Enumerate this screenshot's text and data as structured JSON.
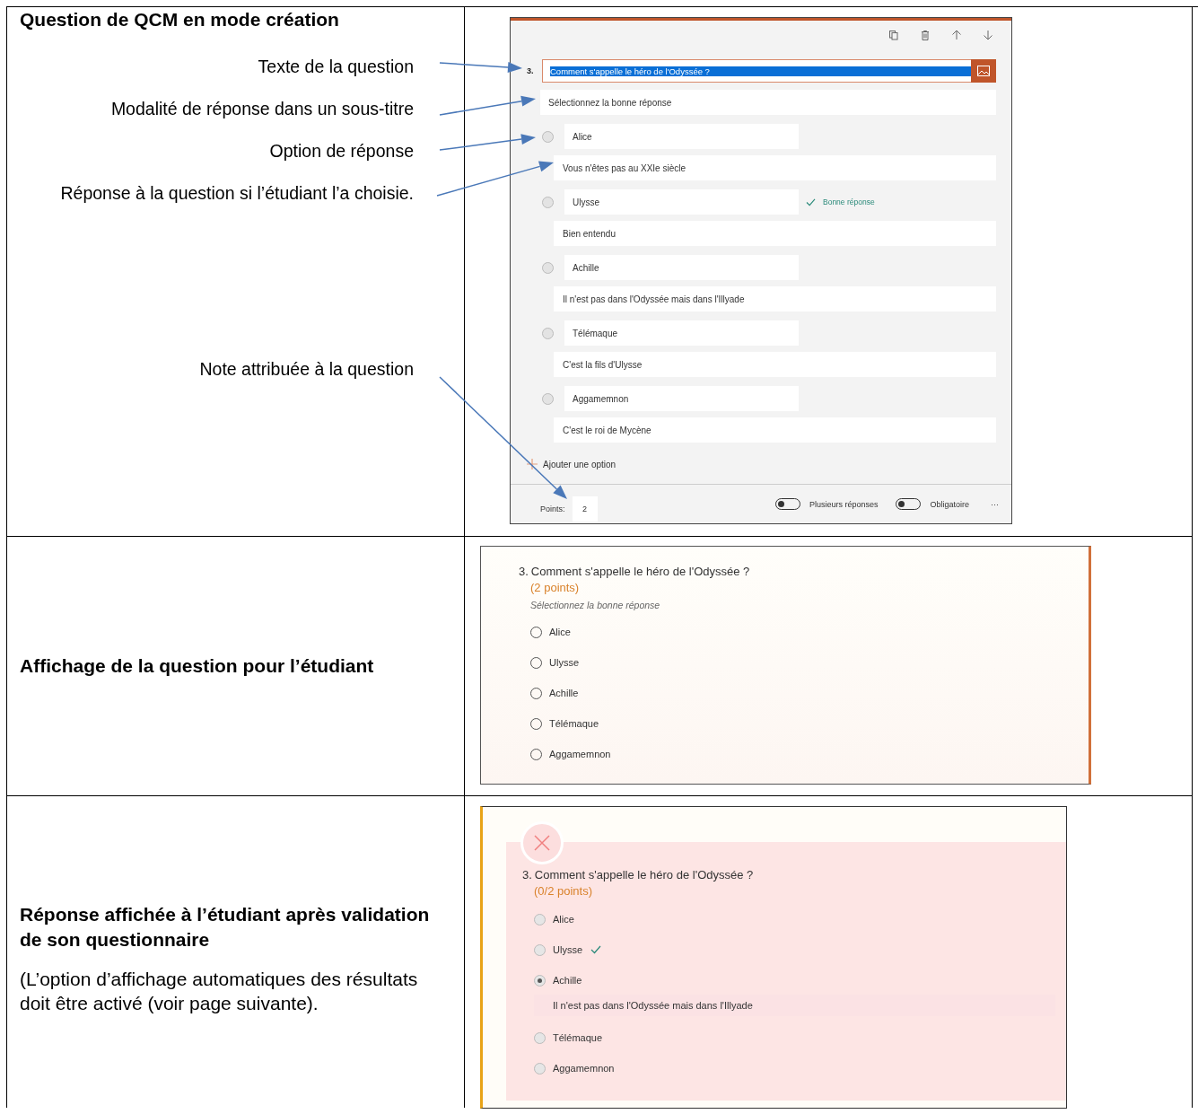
{
  "creation": {
    "heading": "Question de QCM en mode création",
    "annotations": [
      "Texte de la question",
      "Modalité de réponse dans un sous-titre",
      "Option de réponse",
      "Réponse à la question si l’étudiant l’a choisie.",
      "Note attribuée à la question"
    ],
    "editor": {
      "number": "3.",
      "question": "Comment s'appelle le héro de l'Odyssée ?",
      "question_selected": true,
      "subtitle": "Sélectionnez la bonne réponse",
      "correct_label": "Bonne réponse",
      "options": [
        {
          "label": "Alice",
          "feedback": "Vous n'êtes pas au XXIe siècle",
          "correct": false,
          "selected": false
        },
        {
          "label": "Ulysse",
          "feedback": "Bien entendu",
          "correct": true,
          "selected": false
        },
        {
          "label": "Achille",
          "feedback": "Il n'est pas dans l'Odyssée mais dans l'Illyade",
          "correct": false,
          "selected": false
        },
        {
          "label": "Télémaque",
          "feedback": "C'est la fils d'Ulysse",
          "correct": false,
          "selected": false
        },
        {
          "label": "Aggamemnon",
          "feedback": "C'est le roi de Mycène",
          "correct": false,
          "selected": false
        }
      ],
      "add_option": "Ajouter une option",
      "points_label": "Points:",
      "points": "2",
      "toggles": [
        {
          "label": "Plusieurs réponses",
          "on": false
        },
        {
          "label": "Obligatoire",
          "on": false
        }
      ],
      "more": "···"
    }
  },
  "student": {
    "heading": "Affichage de la question pour l’étudiant",
    "form": {
      "number": "3.",
      "question": "Comment s'appelle le héro de l'Odyssée ?",
      "points": "(2 points)",
      "subtitle": "Sélectionnez la bonne réponse",
      "options": [
        {
          "label": "Alice",
          "selected": false
        },
        {
          "label": "Ulysse",
          "selected": false
        },
        {
          "label": "Achille",
          "selected": false
        },
        {
          "label": "Télémaque",
          "selected": false
        },
        {
          "label": "Aggamemnon",
          "selected": false
        }
      ]
    }
  },
  "result": {
    "heading": "Réponse affichée à l’étudiant après validation de son questionnaire",
    "note": "(L’option d’affichage automatiques des résultats doit être activé (voir page suivante).",
    "form": {
      "passed": false,
      "number": "3.",
      "question": "Comment s'appelle le héro de l'Odyssée ?",
      "points": "(0/2 points)",
      "options": [
        {
          "label": "Alice",
          "selected": false,
          "correct": false
        },
        {
          "label": "Ulysse",
          "selected": false,
          "correct": true
        },
        {
          "label": "Achille",
          "selected": true,
          "correct": false,
          "feedback": "Il n'est pas dans l'Odyssée mais dans l'Illyade"
        },
        {
          "label": "Télémaque",
          "selected": false,
          "correct": false
        },
        {
          "label": "Aggamemnon",
          "selected": false,
          "correct": false
        }
      ]
    }
  }
}
